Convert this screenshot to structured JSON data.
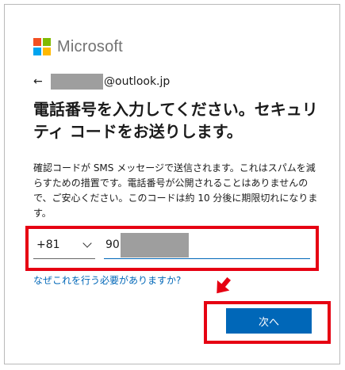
{
  "brand": {
    "name": "Microsoft",
    "logo_colors": [
      "#f25022",
      "#7fba00",
      "#00a4ef",
      "#ffb900"
    ]
  },
  "account": {
    "back_icon": "back-arrow-icon",
    "email_domain": "@outlook.jp"
  },
  "page": {
    "title": "電話番号を入力してください。セキュリティ コードをお送りします。",
    "description": "確認コードが SMS メッセージで送信されます。これはスパムを減らすための措置です。電話番号が公開されることはありませんので、ご安心ください。このコードは約 10 分後に期限切れになります。"
  },
  "phone": {
    "country_code": "+81",
    "number_visible": "90"
  },
  "links": {
    "why": "なぜこれを行う必要がありますか?"
  },
  "buttons": {
    "next": "次へ"
  },
  "colors": {
    "accent": "#0067b8",
    "annotation": "#e60012",
    "redaction": "#9e9e9e"
  }
}
